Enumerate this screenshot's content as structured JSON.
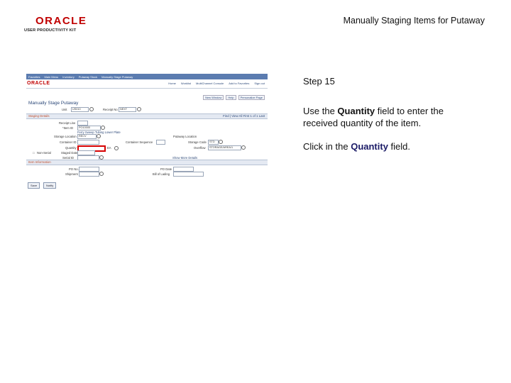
{
  "logo": {
    "brand": "ORACLE",
    "tagline": "USER PRODUCTIVITY KIT"
  },
  "slide": {
    "title": "Manually Staging Items for Putaway",
    "step": "Step 15",
    "instruction_pre": "Use the ",
    "instruction_kw": "Quantity",
    "instruction_post": " field to enter the received quantity of the item.",
    "click_pre": "Click in the ",
    "click_kw": "Quantity",
    "click_post": " field."
  },
  "app": {
    "menubar": [
      "Favorites",
      "Main Menu",
      "Inventory",
      "Putaway Stock",
      "Manually Stage Putaway"
    ],
    "brand": "ORACLE",
    "nav_links": [
      "Home",
      "Worklist",
      "MultiChannel Console",
      "Add to Favorites",
      "Sign out"
    ],
    "top_links": [
      "New Window",
      "Help",
      "Personalize Page"
    ],
    "page_title": "Manually Stage Putaway",
    "unit_label": "Unit",
    "unit_value": "US010",
    "receipt_label": "Receipt No",
    "receipt_value": "NEXT",
    "section_staging": "Staging Details",
    "section_staging_right": "Find | View All  First  1 of 1  Last",
    "receipt_line_label": "Receipt Line",
    "item_label": "*Item ID",
    "item_value": "PO10000",
    "item_desc": "Ferry Sweep Tubing Lower Plate",
    "storage_label": "Storage Location",
    "storage_value": "RECV",
    "container_label": "Container ID",
    "container_seq_label": "Container Sequence",
    "quantity_label": "Quantity",
    "uom_value": "EA",
    "serial_label": "Non-Serial",
    "staged_date_label": "Staged Date",
    "staged_date_value": "",
    "serial_id_label": "Serial ID",
    "putaway_label": "Putaway Location",
    "storage_code_label": "Storage Code",
    "storage_code_value": "STD",
    "overflow_label": "Overflow",
    "overflow_value": "STORAGE/AREA/1",
    "section_po": "Item Information",
    "po_label": "PO No.",
    "po_date_label": "PO Date",
    "shipment_label": "Shipment",
    "bill_label": "Bill of Lading",
    "show_more": "Show More Details",
    "btn_save": "Save",
    "btn_notify": "Notify"
  }
}
